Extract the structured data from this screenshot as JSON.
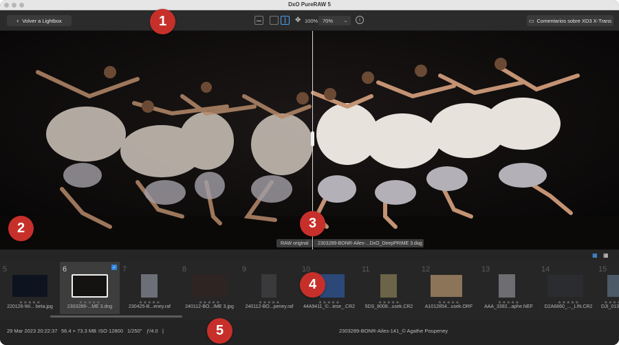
{
  "window": {
    "title": "DxO PureRAW 5"
  },
  "toolbar": {
    "back_label": "Volver a Lightbox",
    "zoom_fit": "100%",
    "zoom_level": "70%",
    "feedback_label": "Comentarios sobre XD3 X-Trans"
  },
  "viewer": {
    "left_label": "RAW original",
    "right_label": "2303289-BONR-Ailes-...DxO_DeepPRIME 3.dng"
  },
  "filmstrip": {
    "items": [
      {
        "num": "5",
        "name": "220126-Wi... beta.jpg",
        "stars": "★★★★★"
      },
      {
        "num": "6",
        "name": "2303289-...ME 3.dng",
        "stars": "★★★★★",
        "selected": true
      },
      {
        "num": "7",
        "name": "230425-B...eney.raf",
        "stars": "★★★★★"
      },
      {
        "num": "8",
        "name": "240112-BO...IME 3.jpg",
        "stars": "★★★★★"
      },
      {
        "num": "9",
        "name": "240112-BO...peney.raf",
        "stars": "★★★★★"
      },
      {
        "num": "10",
        "name": "44A9411_©...iese_.CR2",
        "stars": "★★★★★"
      },
      {
        "num": "11",
        "name": "5DS_8008...usek.CR2",
        "stars": "★★★★★"
      },
      {
        "num": "12",
        "name": "A1012854...usek.ORF",
        "stars": "★★★★★"
      },
      {
        "num": "13",
        "name": "AAA_3392...aphe.NEF",
        "stars": "★★★★★"
      },
      {
        "num": "14",
        "name": "D2A6860_..._LIN.CR2",
        "stars": "★★★★★"
      },
      {
        "num": "15",
        "name": "DJI_013",
        "stars": "★★★★★"
      }
    ]
  },
  "status": {
    "date": "29 Mar 2023 20:22:37",
    "size": "56.4 + 73.3 MB",
    "iso": "ISO 12800",
    "shutter": "1/250\"",
    "aperture": "ƒ/4.0",
    "sep": "|",
    "caption": "2303289-BONR-Ailes-141_© Agathe Poupeney"
  },
  "callouts": [
    "1",
    "2",
    "3",
    "4",
    "5"
  ],
  "colors": {
    "accent": "#2e86de",
    "callout": "#c7302a"
  },
  "icons": [
    "back-chevron-icon",
    "single-view-icon",
    "compare-view-icon",
    "split-view-icon",
    "pan-icon",
    "info-icon",
    "comment-icon",
    "grid-view-icon",
    "list-view-icon"
  ]
}
